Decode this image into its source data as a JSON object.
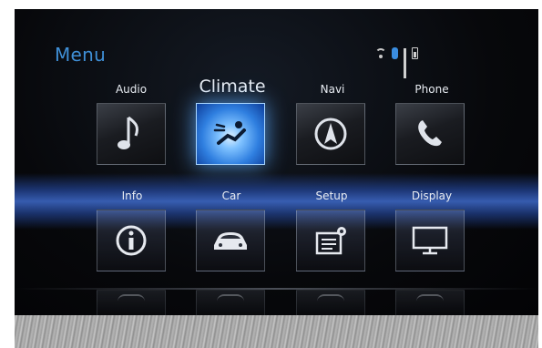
{
  "header": {
    "title": "Menu"
  },
  "status_icons": [
    "wifi-icon",
    "bluetooth-icon",
    "signal-icon",
    "battery-icon"
  ],
  "colors": {
    "accent": "#3f8fd6",
    "active_tile": "#2f7fe0",
    "band": "#4678e6"
  },
  "menu": {
    "row1": [
      {
        "label": "Audio",
        "icon": "music-note-icon"
      },
      {
        "label": "Climate",
        "icon": "climate-seat-icon",
        "selected": true
      },
      {
        "label": "Navi",
        "icon": "compass-icon"
      },
      {
        "label": "Phone",
        "icon": "phone-icon"
      }
    ],
    "row2": [
      {
        "label": "Info",
        "icon": "info-icon"
      },
      {
        "label": "Car",
        "icon": "car-icon"
      },
      {
        "label": "Setup",
        "icon": "setup-icon"
      },
      {
        "label": "Display",
        "icon": "display-icon"
      }
    ]
  }
}
